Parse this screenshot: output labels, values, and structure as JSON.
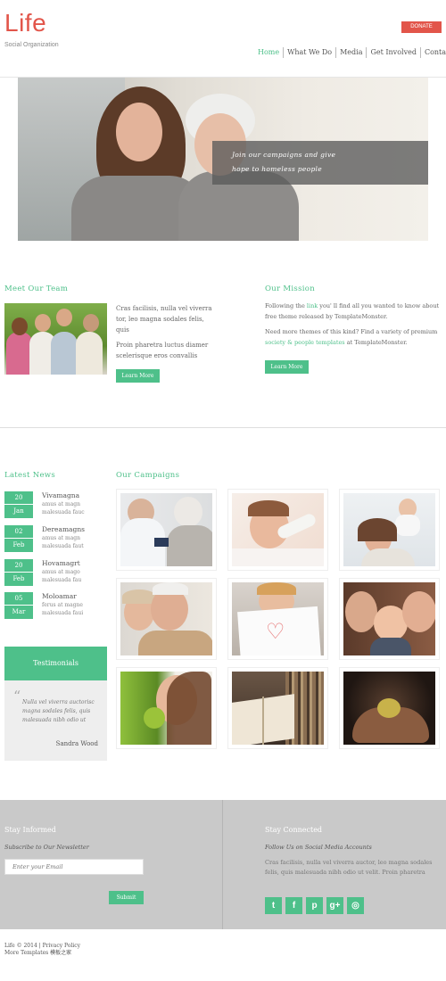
{
  "header": {
    "logo": "Life",
    "tagline": "Social Organization",
    "donate_label": "DONATE",
    "nav": [
      "Home",
      "What We Do",
      "Media",
      "Get Involved",
      "Contacts"
    ],
    "active_nav": "Home"
  },
  "hero": {
    "caption_line1": "Join our campaigns and give",
    "caption_line2": "hope to homeless people"
  },
  "team": {
    "title": "Meet Our Team",
    "para1": "Cras facilisis, nulla vel viverra tor, leo magna sodales felis, quis",
    "para2": "Proin pharetra luctus diamer scelerisque eros convallis",
    "button": "Learn More"
  },
  "mission": {
    "title": "Our Mission",
    "para1_before": "Following the ",
    "para1_link": "link",
    "para1_after": " you' ll find all you wanted to know about free theme released by TemplateMonster.",
    "para2_before": "Need more themes of this kind? Find a variety of premium ",
    "para2_link": "society & people templates",
    "para2_after": " at TemplateMonster.",
    "button": "Learn More"
  },
  "news": {
    "title": "Latest News",
    "items": [
      {
        "day": "20",
        "month": "Jan",
        "title": "Vivamagna",
        "desc": "amus at magn malesuada fauc"
      },
      {
        "day": "02",
        "month": "Feb",
        "title": "Dereamagns",
        "desc": "amus at magn malesuada faut"
      },
      {
        "day": "20",
        "month": "Feb",
        "title": "Hovamagrt",
        "desc": "amus at mago malesuada fau"
      },
      {
        "day": "05",
        "month": "Mar",
        "title": "Moloamar",
        "desc": "ferus at magne malesuada faui"
      }
    ]
  },
  "testimonials": {
    "title": "Testimonials",
    "quote": "Nulla vel viverra auctorisc magna sodales felis, quis malesuada nibh odio ut",
    "author": "Sandra Wood"
  },
  "campaigns": {
    "title": "Our Campaigns"
  },
  "footer": {
    "informed_title": "Stay Informed",
    "informed_sub": "Subscribe to Our Newsletter",
    "email_placeholder": "Enter your Email",
    "submit": "Submit",
    "connected_title": "Stay Connected",
    "connected_sub": "Follow Us on Social Media Accounts",
    "connected_text": "Cras facilisis, nulla vel viverra auctor, leo magna sodales felis, quis malesuada nibh odio ut velit. Proin pharetra",
    "social": [
      "twitter",
      "facebook",
      "pinterest",
      "google-plus",
      "instagram"
    ],
    "social_glyphs": [
      "t",
      "f",
      "p",
      "g+",
      "◎"
    ],
    "copyright": "Life © 2014 | Privacy Policy",
    "more": "More Templates 模板之家"
  },
  "colors": {
    "accent": "#4ec08a",
    "logo": "#e2554a",
    "footer_bg": "#c9c9c9"
  }
}
